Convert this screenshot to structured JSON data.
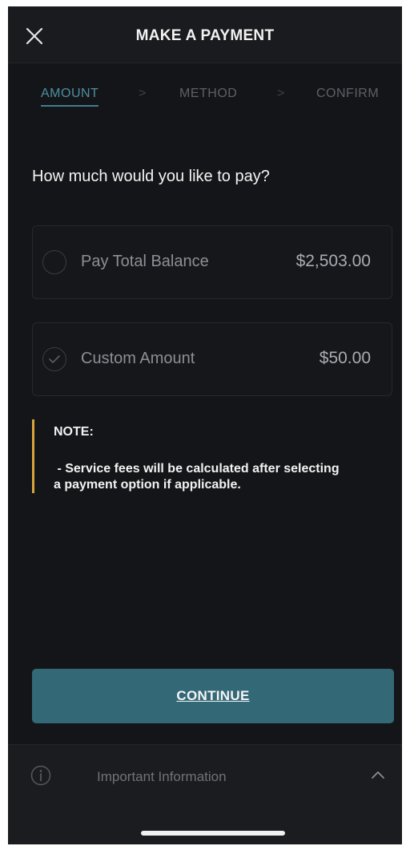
{
  "header": {
    "title": "MAKE A PAYMENT",
    "close_icon": "close-icon"
  },
  "steps": {
    "items": [
      {
        "label": "AMOUNT",
        "state": "active"
      },
      {
        "label": "METHOD",
        "state": "inactive"
      },
      {
        "label": "CONFIRM",
        "state": "inactive"
      }
    ],
    "separator_icon": "chevron-right-icon"
  },
  "question": "How much would you like to pay?",
  "options": [
    {
      "label": "Pay Total Balance",
      "amount": "$2,503.00",
      "selected": false
    },
    {
      "label": "Custom Amount",
      "amount": "$50.00",
      "selected": true
    }
  ],
  "note": {
    "title": "NOTE:",
    "line1": " - Service fees will be calculated after selecting",
    "line2": "a payment option if applicable."
  },
  "continue_label": "CONTINUE",
  "info_bar": {
    "label": "Important Information",
    "icon": "info-icon",
    "toggle_icon": "chevron-up-icon"
  },
  "colors": {
    "background": "#141518",
    "accent": "#336876",
    "active_step": "#4d8fa3",
    "note_bar": "#d9a53a"
  }
}
